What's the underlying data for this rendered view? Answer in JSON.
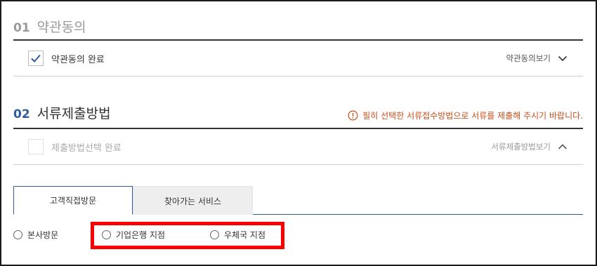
{
  "section1": {
    "number": "01",
    "title": "약관동의",
    "check_label": "약관동의 완료",
    "checked": true,
    "toggle_label": "약관동의보기",
    "toggle_icon": "chevron-down-icon"
  },
  "section2": {
    "number": "02",
    "title": "서류제출방법",
    "notice": "필히 선택한 서류접수방법으로 서류를 제출해 주시기 바랍니다.",
    "notice_icon": "info-circle-icon",
    "check_label": "제출방법선택 완료",
    "checked": false,
    "toggle_label": "서류제출방법보기",
    "toggle_icon": "chevron-up-icon"
  },
  "tabs": [
    {
      "label": "고객직접방문",
      "active": true
    },
    {
      "label": "찾아가는 서비스",
      "active": false
    }
  ],
  "radios": [
    {
      "label": "본사방문",
      "selected": false
    },
    {
      "label": "기업은행 지점",
      "selected": false
    },
    {
      "label": "우체국 지점",
      "selected": false
    }
  ],
  "colors": {
    "accent": "#2f5c9a",
    "notice": "#c8501e",
    "highlight": "#ff0000",
    "check": "#2f5c9a"
  }
}
